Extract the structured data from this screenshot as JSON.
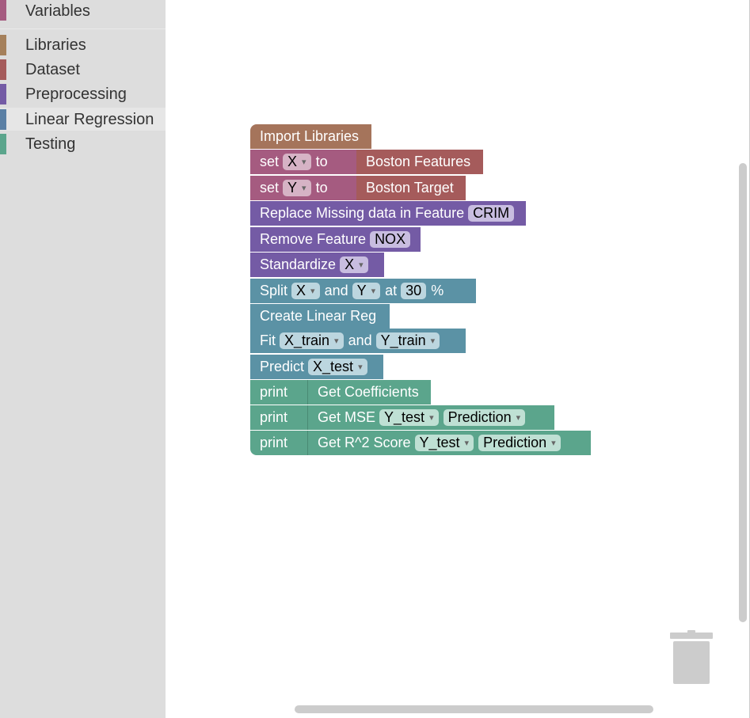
{
  "toolbox": {
    "categories": [
      {
        "label": "Variables",
        "color": "#a55b80"
      },
      {
        "label": "Libraries",
        "color": "#a5805b"
      },
      {
        "label": "Dataset",
        "color": "#a55b5b"
      },
      {
        "label": "Preprocessing",
        "color": "#745ba5"
      },
      {
        "label": "Linear Regression",
        "color": "#5b80a5"
      },
      {
        "label": "Testing",
        "color": "#5ba58c"
      }
    ],
    "selected": "Linear Regression"
  },
  "blocks": {
    "import_libraries": {
      "text": "Import Libraries",
      "color": "#a5745b"
    },
    "set_x": {
      "set": "set",
      "var": "X",
      "to": "to",
      "value": "Boston Features",
      "color": "#a55b80",
      "value_color": "#a55b5b"
    },
    "set_y": {
      "set": "set",
      "var": "Y",
      "to": "to",
      "value": "Boston Target",
      "color": "#a55b80",
      "value_color": "#a55b5b"
    },
    "replace_missing": {
      "text": "Replace Missing data in Feature",
      "field": "CRIM",
      "color": "#745ba5"
    },
    "remove_feature": {
      "text": "Remove Feature",
      "field": "NOX",
      "color": "#745ba5"
    },
    "standardize": {
      "text": "Standardize",
      "var": "X",
      "color": "#745ba5"
    },
    "split": {
      "text": "Split",
      "var1": "X",
      "and": "and",
      "var2": "Y",
      "at": "at",
      "pct": "30",
      "pct_sign": "%",
      "color": "#5b92a5"
    },
    "create_linear_reg": {
      "text": "Create Linear Reg",
      "color": "#5b92a5"
    },
    "fit": {
      "text": "Fit",
      "var1": "X_train",
      "and": "and",
      "var2": "Y_train",
      "color": "#5b92a5"
    },
    "predict": {
      "text": "Predict",
      "var": "X_test",
      "color": "#5b92a5"
    },
    "print_coef": {
      "print": "print",
      "inner": "Get Coefficients",
      "color": "#5ba58c"
    },
    "print_mse": {
      "print": "print",
      "inner": "Get MSE",
      "var1": "Y_test",
      "var2": "Prediction",
      "color": "#5ba58c"
    },
    "print_r2": {
      "print": "print",
      "inner": "Get R^2 Score",
      "var1": "Y_test",
      "var2": "Prediction",
      "color": "#5ba58c"
    }
  }
}
